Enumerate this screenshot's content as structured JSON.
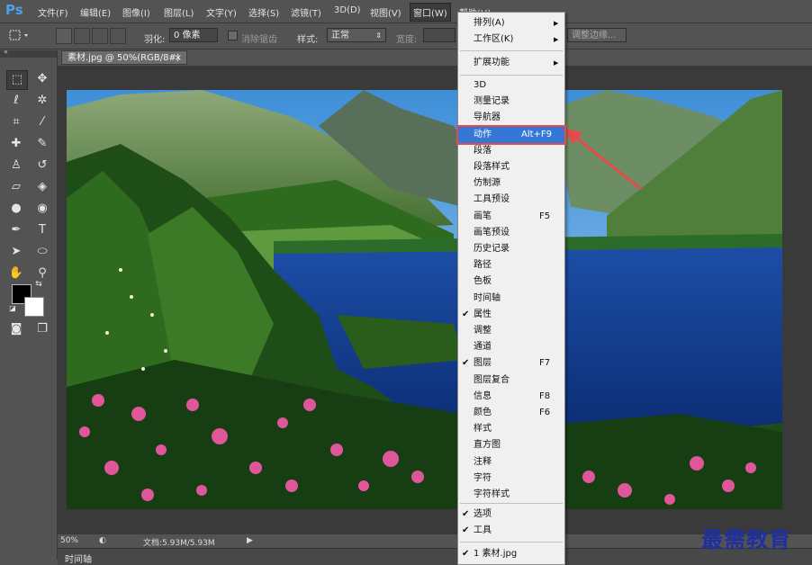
{
  "app": {
    "logo": "Ps"
  },
  "menubar": {
    "items": [
      "文件(F)",
      "编辑(E)",
      "图像(I)",
      "图层(L)",
      "文字(Y)",
      "选择(S)",
      "滤镜(T)",
      "3D(D)",
      "视图(V)",
      "窗口(W)",
      "帮助(H)"
    ],
    "active_index": 9
  },
  "options": {
    "feather_label": "羽化:",
    "feather_value": "0 像素",
    "antialias_label": "消除锯齿",
    "style_label": "样式:",
    "style_value": "正常",
    "width_label": "宽度:",
    "refine_edge": "调整边缘..."
  },
  "document": {
    "tab_title": "素材.jpg @ 50%(RGB/8#)",
    "tab_close": "×"
  },
  "status": {
    "zoom": "50%",
    "doc_info": "文档:5.93M/5.93M"
  },
  "timeline": {
    "label": "时间轴"
  },
  "window_menu": {
    "top_items": [
      {
        "label": "排列(A)",
        "submenu": true
      },
      {
        "label": "工作区(K)",
        "submenu": true
      },
      {
        "label": "扩展功能",
        "submenu": true
      }
    ],
    "items": [
      {
        "label": "3D",
        "shortcut": "",
        "checked": false
      },
      {
        "label": "测量记录",
        "shortcut": "",
        "checked": false
      },
      {
        "label": "导航器",
        "shortcut": "",
        "checked": false
      },
      {
        "label": "动作",
        "shortcut": "Alt+F9",
        "checked": false,
        "highlighted": true
      },
      {
        "label": "段落",
        "shortcut": "",
        "checked": false
      },
      {
        "label": "段落样式",
        "shortcut": "",
        "checked": false
      },
      {
        "label": "仿制源",
        "shortcut": "",
        "checked": false
      },
      {
        "label": "工具预设",
        "shortcut": "",
        "checked": false
      },
      {
        "label": "画笔",
        "shortcut": "F5",
        "checked": false
      },
      {
        "label": "画笔预设",
        "shortcut": "",
        "checked": false
      },
      {
        "label": "历史记录",
        "shortcut": "",
        "checked": false
      },
      {
        "label": "路径",
        "shortcut": "",
        "checked": false
      },
      {
        "label": "色板",
        "shortcut": "",
        "checked": false
      },
      {
        "label": "时间轴",
        "shortcut": "",
        "checked": false
      },
      {
        "label": "属性",
        "shortcut": "",
        "checked": true
      },
      {
        "label": "调整",
        "shortcut": "",
        "checked": false
      },
      {
        "label": "通道",
        "shortcut": "",
        "checked": false
      },
      {
        "label": "图层",
        "shortcut": "F7",
        "checked": true
      },
      {
        "label": "图层复合",
        "shortcut": "",
        "checked": false
      },
      {
        "label": "信息",
        "shortcut": "F8",
        "checked": false
      },
      {
        "label": "颜色",
        "shortcut": "F6",
        "checked": false
      },
      {
        "label": "样式",
        "shortcut": "",
        "checked": false
      },
      {
        "label": "直方图",
        "shortcut": "",
        "checked": false
      },
      {
        "label": "注释",
        "shortcut": "",
        "checked": false
      },
      {
        "label": "字符",
        "shortcut": "",
        "checked": false
      },
      {
        "label": "字符样式",
        "shortcut": "",
        "checked": false
      }
    ],
    "bottom_items": [
      {
        "label": "选项",
        "checked": true
      },
      {
        "label": "工具",
        "checked": true
      },
      {
        "label": "1 素材.jpg",
        "checked": true
      }
    ]
  },
  "watermark": "最需教育",
  "colors": {
    "highlight": "#3577d6",
    "arrow": "#e84a4a",
    "watermark": "#1f2fa0"
  }
}
